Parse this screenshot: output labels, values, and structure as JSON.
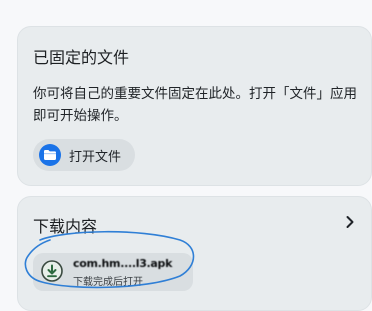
{
  "pinned": {
    "title": "已固定的文件",
    "description": "你可将自己的重要文件固定在此处。打开「文件」应用即可开始操作。",
    "open_files_label": "打开文件",
    "files_icon": "folder-icon"
  },
  "downloads": {
    "title": "下载内容",
    "chevron_icon": "chevron-right-icon",
    "item": {
      "filename": "com.hm....l3.apk",
      "status": "下载完成后打开",
      "icon": "download-icon"
    }
  },
  "colors": {
    "accent": "#1a73e8",
    "annotation": "#2f7fd6",
    "card_background": "#e8ecee",
    "chip_background": "#d9dee1"
  }
}
